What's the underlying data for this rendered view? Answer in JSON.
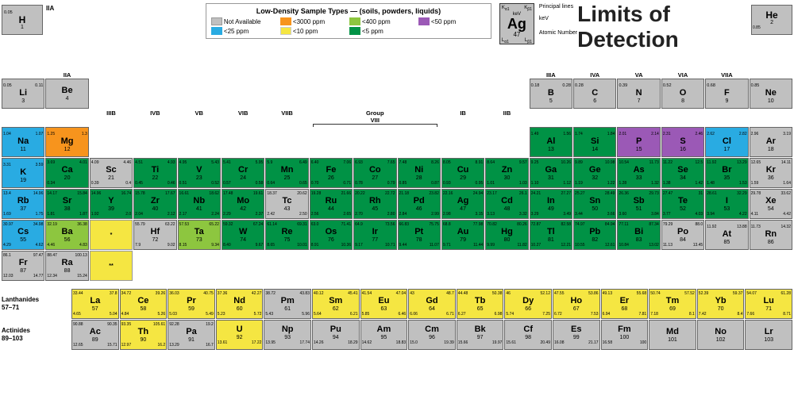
{
  "title": "Limits of Detection",
  "legend": {
    "title": "Low-Density Sample Types — (soils, powders, liquids)",
    "items": [
      {
        "label": "Not Available",
        "color": "#c0c0c0"
      },
      {
        "label": "<3000 ppm",
        "color": "#f7941d"
      },
      {
        "label": "<400 ppm",
        "color": "#8dc63f"
      },
      {
        "label": "<50 ppm",
        "color": "#9b59b6"
      },
      {
        "label": "<25 ppm",
        "color": "#29abe2"
      },
      {
        "label": "<10 ppm",
        "color": "#f5e642"
      },
      {
        "label": "<5 ppm",
        "color": "#009245"
      }
    ]
  },
  "symbol_box": {
    "top_left": "K_a1",
    "top_right": "K_b1",
    "unit_top": "keV",
    "symbol": "Ag",
    "number": "47",
    "keV_label": "keV",
    "bottom_left": "L_a1",
    "bottom_right": "L_b1",
    "principal_lines": "Principal lines",
    "atomic_number": "Atomic Number"
  },
  "elements": {
    "period1": [
      {
        "sym": "H",
        "num": 1,
        "m1": "",
        "m2": "",
        "l1": "",
        "l2": "",
        "col": "bg-gray"
      },
      {
        "sym": "He",
        "num": 2,
        "m1": "",
        "m2": "",
        "l1": "",
        "l2": "",
        "col": "bg-gray"
      }
    ]
  }
}
